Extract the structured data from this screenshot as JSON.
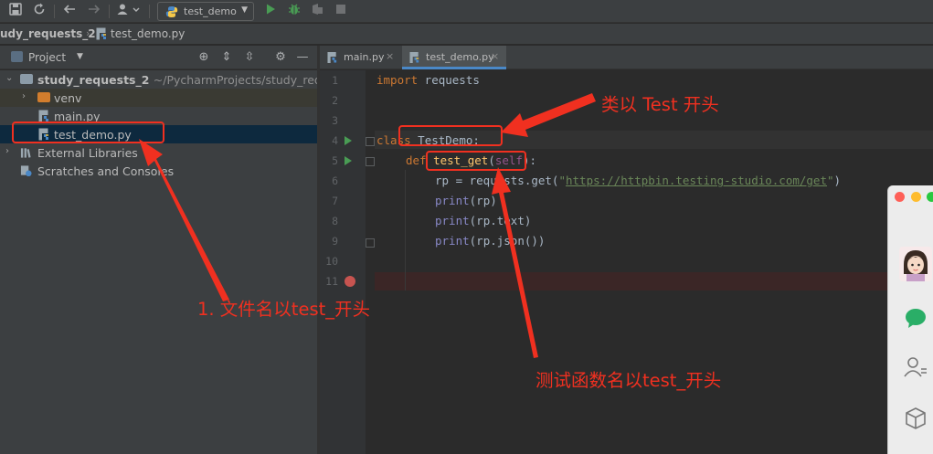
{
  "toolbar": {
    "run_config": "test_demo",
    "icons": [
      "save-icon",
      "sync-icon",
      "back-icon",
      "forward-icon",
      "vcs-user-icon",
      "run-icon",
      "debug-icon",
      "coverage-icon",
      "stop-icon"
    ]
  },
  "breadcrumb": {
    "project": "udy_requests_2",
    "file": "test_demo.py"
  },
  "project_panel": {
    "title": "Project",
    "tree": {
      "root_name": "study_requests_2",
      "root_path": "~/PycharmProjects/study_reques",
      "venv": "venv",
      "main": "main.py",
      "test_demo": "test_demo.py",
      "external": "External Libraries",
      "scratches": "Scratches and Consoles"
    }
  },
  "editor": {
    "tabs": [
      {
        "label": "main.py",
        "close": "×"
      },
      {
        "label": "test_demo.py",
        "close": "×"
      }
    ],
    "line_numbers": [
      "1",
      "2",
      "3",
      "4",
      "5",
      "6",
      "7",
      "8",
      "9",
      "10",
      "11"
    ],
    "code": {
      "l1_kw": "import",
      "l1_rest": " requests",
      "l4_kw": "class",
      "l4_rest": " TestDemo:",
      "l5_kw": "def",
      "l5_fn": "test_get",
      "l5_self": "self",
      "l6_pre": "rp = requests.get(",
      "l6_url": "https://httpbin.testing-studio.com/get",
      "l6_post": ")",
      "l7_bi": "print",
      "l7_rest": "(rp)",
      "l8_bi": "print",
      "l8_rest": "(rp.text)",
      "l9_bi": "print",
      "l9_rest": "(rp.json())"
    }
  },
  "annotations": {
    "class_note": "类以 Test 开头",
    "file_note": "1. 文件名以test_开头",
    "func_note": "测试函数名以test_开头",
    "color": "#f03020"
  },
  "colors": {
    "background": "#2b2b2b",
    "panel": "#3c3f41",
    "keyword": "#cc7832",
    "function": "#ffc66d",
    "string": "#6a8759",
    "run_green": "#499c54"
  }
}
